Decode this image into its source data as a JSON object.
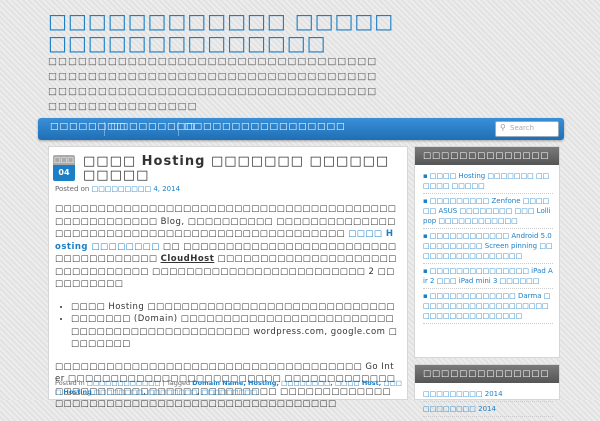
{
  "site": {
    "title": "□□□□□□□□□□□□ □□□□□□□□□□□□□□□□□□□",
    "description": "□□□□□□□□□□□□□□□□□□□□□□□□□□□□□□□□□□□□□□□□□□□□□□□□□□□□□□□□□□□□□□□□□□□□□□□□□□□□□□□□□□□□□□□□□□□□□□□□□□□□□□□□□□□□□□□□□□"
  },
  "nav": {
    "items": [
      "□□□□□□□□",
      "□□□□□□□□□",
      "□□□□□□□□□□□□□□□□□"
    ],
    "search_placeholder": "Search"
  },
  "post": {
    "date_month": "□□□",
    "date_day": "04",
    "title": "□□□□ Hosting □□□□□□□ □□□□□□ □□□□□",
    "posted_on_label": "Posted on",
    "posted_date": "□□□□□□□□□ 4, 2014",
    "para1_a": "□□□□□□□□□□□□□□□□□□□□□□□□□□□□□□□□□□□□□□□□ □□□□□□□□□□□□ Blog, □□□□□□□□□□ □□□□□□□□□□□□□□□□□□□□□□□□□□□□□□□□□□□□□□□□□□□□□□□□",
    "para1_link": "□□□□ Hosting □□□□□□□□",
    "para1_b": "□□ □□□□□□□□□□□□□□□□□□□□□□□□□□□□□□□□□□□□□",
    "para1_cloudhost": "CloudHost",
    "para1_c": "□□□□□□□□□□□□□□□□□□□□□□□□□□□□□□□□ □□□□□□□□□□□□□□□□□□□□□□□□□ 2 □□□□□□□□□□",
    "bullet1": "□□□□ Hosting □□□□□□□□□□□□□□□□□□□□□□□□□□□□□",
    "bullet2": "□□□□□□□ (Domain) □□□□□□□□□□□□□□□□□□□□□□□□□□□□□□□□□□□□□□□□□□□□□□ wordpress.com, google.com □□□□□□□□",
    "para2": "□□□□□□□□□□□□□□□□□□□□□□□□□□□□□□□□□□□□ Go Inter □□□□□□□□□□□□□□□□□□□□□□□□□ □□□□□□□□□□□□□□□□□□□□□□□□□□□□□□□□□□□□□□□ □□□□□□□□□□□□□□□□□□□□□□□□□□□□□□□□□□□□□□□□□□□□□□",
    "posted_in_label": "Posted in",
    "category": "□□□□□□□□□□□□",
    "tagged_label": "| Tagged",
    "tags": "Domain Name, Hosting, □□□□□□□□, □□□□ Host, □□□□ Hosting □□□□□□□□, □□□□□□□□, □□□□□□□□□"
  },
  "sidebar": {
    "widget1_title": "□□□□□□□□□□□□□□",
    "recent_posts": [
      "□□□□ Hosting □□□□□□□ □□□□□□ □□□□□",
      "□□□□□□□□□ Zenfone □□□□□□ ASUS □□□□□□□□ □□□ Lollipop □□□□□□□□□□□□",
      "□□□□□□□□□□□□ Android 5.0 □□□□□□□□□ Screen pinning □□□□□□□□□□□□□□□□□",
      "□□□□□□□□□□□□□□□ iPad Air 2 □□□ iPad mini 3 □□□□□□",
      "□□□□□□□□□□□□□ Darma □□□□□□□□□□□□□□□□□□□□ □□□□□□□□□□□□□□□"
    ],
    "widget2_title": "□□□□□□□□□□□□□□",
    "archives": [
      "□□□□□□□□□ 2014",
      "□□□□□□□□ 2014"
    ]
  },
  "colors": {
    "accent": "#1c7fc6",
    "nav_bg": "#2a7fc8",
    "widget_title_bg": "#666666"
  }
}
